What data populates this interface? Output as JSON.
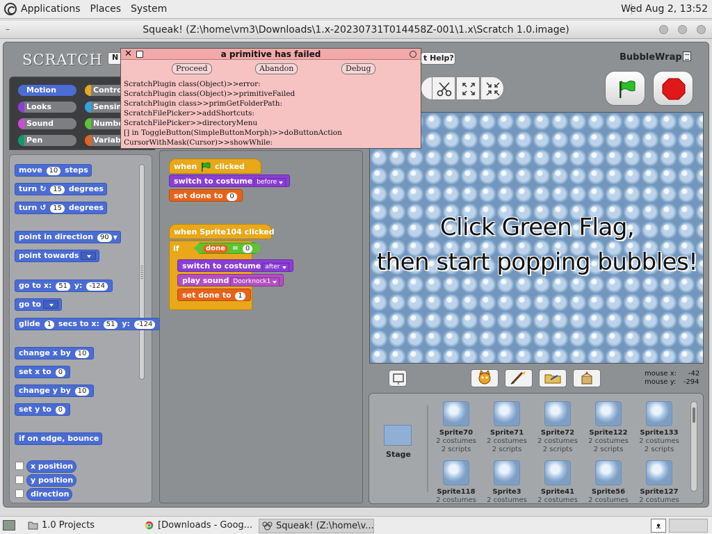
{
  "top_panel": {
    "menus": [
      "Applications",
      "Places",
      "System"
    ],
    "clock": "Wed Aug  2, 13:52"
  },
  "window": {
    "title": "Squeak! (Z:\\home\\vm3\\Downloads\\1.x-20230731T014458Z-001\\1.x\\Scratch 1.0.image)"
  },
  "scratch": {
    "logo": "SCRATCH",
    "new_button": "N",
    "help_button": "t Help?",
    "project_name": "BubbleWrap",
    "categories": [
      {
        "label": "Motion",
        "color": "#4a6cd4",
        "selected": true
      },
      {
        "label": "Control",
        "color": "#e8a81a",
        "selected": false
      },
      {
        "label": "Looks",
        "color": "#8a3ed4",
        "selected": false
      },
      {
        "label": "Sensing",
        "color": "#2ca5e2",
        "selected": false
      },
      {
        "label": "Sound",
        "color": "#cf4ad9",
        "selected": false
      },
      {
        "label": "Numbers",
        "color": "#5ac531",
        "selected": false
      },
      {
        "label": "Pen",
        "color": "#0e9a6c",
        "selected": false
      },
      {
        "label": "Variables",
        "color": "#e8631a",
        "selected": false
      }
    ],
    "palette_blocks": {
      "move": {
        "pre": "move",
        "arg": "10",
        "post": "steps"
      },
      "turn_cw": {
        "pre": "turn",
        "arg": "15",
        "post": "degrees"
      },
      "turn_ccw": {
        "pre": "turn",
        "arg": "15",
        "post": "degrees"
      },
      "point_dir": {
        "pre": "point in direction",
        "arg": "90"
      },
      "point_towards": {
        "pre": "point towards"
      },
      "goto_xy": {
        "pre": "go to x:",
        "x": "51",
        "ylab": "y:",
        "y": "-124"
      },
      "goto": {
        "pre": "go to"
      },
      "glide": {
        "pre": "glide",
        "secs": "1",
        "mid": "secs to x:",
        "x": "51",
        "ylab": "y:",
        "y": "-124"
      },
      "change_x": {
        "pre": "change x by",
        "arg": "10"
      },
      "set_x": {
        "pre": "set x to",
        "arg": "0"
      },
      "change_y": {
        "pre": "change y by",
        "arg": "10"
      },
      "set_y": {
        "pre": "set y to",
        "arg": "0"
      },
      "bounce": {
        "pre": "if on edge, bounce"
      },
      "x_position": "x position",
      "y_position": "y position",
      "direction": "direction"
    },
    "script1": {
      "hat_pre": "when",
      "hat_post": "clicked",
      "switch_pre": "switch to costume",
      "switch_arg": "before",
      "set_pre": "set",
      "set_var": "done",
      "set_mid": "to",
      "set_val": "0"
    },
    "script2": {
      "hat": "when Sprite104 clicked",
      "if_label": "if",
      "cond_var": "done",
      "cond_op": "=",
      "cond_val": "0",
      "switch_pre": "switch to costume",
      "switch_arg": "after",
      "sound_pre": "play sound",
      "sound_arg": "Doorknock1",
      "set_pre": "set",
      "set_var": "done",
      "set_mid": "to",
      "set_val": "1"
    },
    "stage_text": {
      "line1": "Click Green Flag,",
      "line2": "then start popping bubbles!"
    },
    "mouse": {
      "x_label": "mouse x:",
      "x": "-42",
      "y_label": "mouse y:",
      "y": "-294"
    },
    "stage_label": "Stage",
    "sprites": [
      {
        "name": "Sprite70",
        "costumes": "2 costumes",
        "scripts": "2 scripts"
      },
      {
        "name": "Sprite71",
        "costumes": "2 costumes",
        "scripts": "2 scripts"
      },
      {
        "name": "Sprite72",
        "costumes": "2 costumes",
        "scripts": "2 scripts"
      },
      {
        "name": "Sprite122",
        "costumes": "2 costumes",
        "scripts": "2 scripts"
      },
      {
        "name": "Sprite133",
        "costumes": "2 costumes",
        "scripts": "2 scripts"
      },
      {
        "name": "Sprite118",
        "costumes": "2 costumes",
        "scripts": ""
      },
      {
        "name": "Sprite3",
        "costumes": "2 costumes",
        "scripts": ""
      },
      {
        "name": "Sprite41",
        "costumes": "2 costumes",
        "scripts": ""
      },
      {
        "name": "Sprite56",
        "costumes": "2 costumes",
        "scripts": ""
      },
      {
        "name": "Sprite127",
        "costumes": "2 costumes",
        "scripts": ""
      }
    ]
  },
  "dialog": {
    "title": "a primitive has failed",
    "buttons": {
      "proceed": "Proceed",
      "abandon": "Abandon",
      "debug": "Debug"
    },
    "lines": [
      "ScratchPlugin class(Object)>>error:",
      "ScratchPlugin class(Object)>>primitiveFailed",
      "ScratchPlugin class>>primGetFolderPath:",
      "ScratchFilePicker>>addShortcuts:",
      "ScratchFilePicker>>directoryMenu",
      "[] in ToggleButton(SimpleButtonMorph)>>doButtonAction",
      "CursorWithMask(Cursor)>>showWhile:"
    ]
  },
  "taskbar": {
    "items": [
      "1.0 Projects",
      "[Downloads - Goog...",
      "Squeak! (Z:\\home\\v..."
    ]
  }
}
